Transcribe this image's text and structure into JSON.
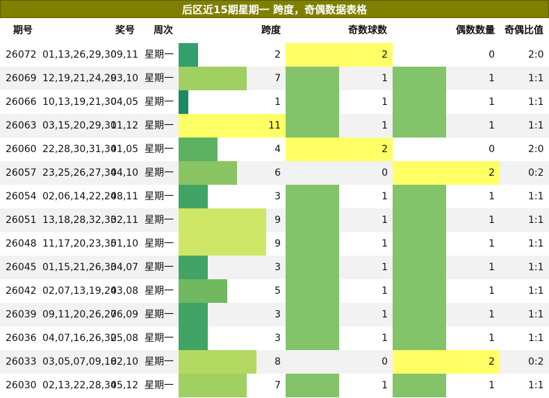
{
  "title": "后区近15期星期一 跨度，奇偶数据表格",
  "headers": {
    "period": "期号",
    "numbers": "奖号",
    "weekday": "周次",
    "span": "跨度",
    "odd_count": "奇数球数",
    "even_count": "偶数数量",
    "ratio": "奇偶比值"
  },
  "colors": {
    "title_bg": "#7f7f00",
    "highlight_yellow": "#ffff66",
    "count_green": "#83c36a",
    "span_scale": {
      "1": "#1a8a62",
      "2": "#33a06c",
      "3": "#42a464",
      "4": "#5db162",
      "5": "#70b960",
      "6": "#8bc462",
      "7": "#a0cf62",
      "8": "#b4d962",
      "9": "#cfe766",
      "11": "#ffff66"
    }
  },
  "rows": [
    {
      "period": "26072",
      "front": "01,13,26,29,30",
      "back": "09,11",
      "weekday": "星期一",
      "span": 2,
      "odd": 2,
      "even": 0,
      "ratio": "2:0"
    },
    {
      "period": "26069",
      "front": "12,19,21,24,29",
      "back": "03,10",
      "weekday": "星期一",
      "span": 7,
      "odd": 1,
      "even": 1,
      "ratio": "1:1"
    },
    {
      "period": "26066",
      "front": "10,13,19,21,30",
      "back": "04,05",
      "weekday": "星期一",
      "span": 1,
      "odd": 1,
      "even": 1,
      "ratio": "1:1"
    },
    {
      "period": "26063",
      "front": "03,15,20,29,31",
      "back": "01,12",
      "weekday": "星期一",
      "span": 11,
      "odd": 1,
      "even": 1,
      "ratio": "1:1"
    },
    {
      "period": "26060",
      "front": "22,28,30,31,34",
      "back": "01,05",
      "weekday": "星期一",
      "span": 4,
      "odd": 2,
      "even": 0,
      "ratio": "2:0"
    },
    {
      "period": "26057",
      "front": "23,25,26,27,34",
      "back": "04,10",
      "weekday": "星期一",
      "span": 6,
      "odd": 0,
      "even": 2,
      "ratio": "0:2"
    },
    {
      "period": "26054",
      "front": "02,06,14,22,24",
      "back": "08,11",
      "weekday": "星期一",
      "span": 3,
      "odd": 1,
      "even": 1,
      "ratio": "1:1"
    },
    {
      "period": "26051",
      "front": "13,18,28,32,33",
      "back": "02,11",
      "weekday": "星期一",
      "span": 9,
      "odd": 1,
      "even": 1,
      "ratio": "1:1"
    },
    {
      "period": "26048",
      "front": "11,17,20,23,35",
      "back": "01,10",
      "weekday": "星期一",
      "span": 9,
      "odd": 1,
      "even": 1,
      "ratio": "1:1"
    },
    {
      "period": "26045",
      "front": "01,15,21,26,33",
      "back": "04,07",
      "weekday": "星期一",
      "span": 3,
      "odd": 1,
      "even": 1,
      "ratio": "1:1"
    },
    {
      "period": "26042",
      "front": "02,07,13,19,24",
      "back": "03,08",
      "weekday": "星期一",
      "span": 5,
      "odd": 1,
      "even": 1,
      "ratio": "1:1"
    },
    {
      "period": "26039",
      "front": "09,11,20,26,27",
      "back": "06,09",
      "weekday": "星期一",
      "span": 3,
      "odd": 1,
      "even": 1,
      "ratio": "1:1"
    },
    {
      "period": "26036",
      "front": "04,07,16,26,32",
      "back": "05,08",
      "weekday": "星期一",
      "span": 3,
      "odd": 1,
      "even": 1,
      "ratio": "1:1"
    },
    {
      "period": "26033",
      "front": "03,05,07,09,18",
      "back": "02,10",
      "weekday": "星期一",
      "span": 8,
      "odd": 0,
      "even": 2,
      "ratio": "0:2"
    },
    {
      "period": "26030",
      "front": "02,13,22,28,34",
      "back": "05,12",
      "weekday": "星期一",
      "span": 7,
      "odd": 1,
      "even": 1,
      "ratio": "1:1"
    }
  ]
}
